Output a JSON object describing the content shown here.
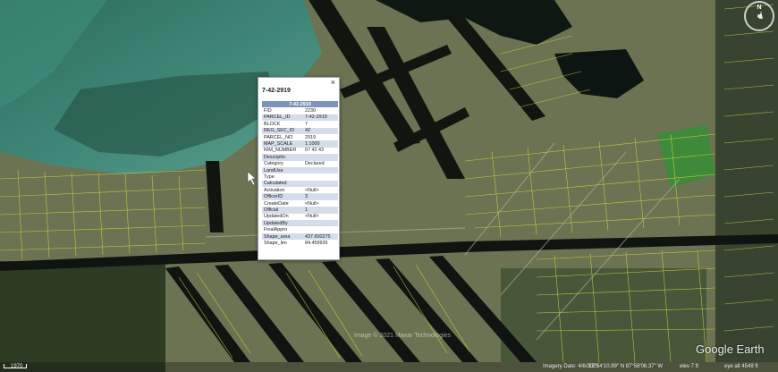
{
  "app": {
    "brand": "Google Earth",
    "watermark": "Image © 2021 Maxar Technologies"
  },
  "compass": {
    "north_label": "N"
  },
  "map": {
    "colors": {
      "sea_deep": "#1f4a3c",
      "sea_shallow": "#3f8576",
      "land": "#6b7352",
      "vegetation": "#2d3b22",
      "canal": "#0f1410",
      "parcel_line": "#d8dc3a"
    }
  },
  "popup": {
    "title": "7-42-2919",
    "table_header": "7-42-2919",
    "close_icon": "close-icon",
    "rows": [
      {
        "field": "FID",
        "value": "2230"
      },
      {
        "field": "PARCEL_ID",
        "value": "7-42-2919"
      },
      {
        "field": "BLOCK",
        "value": "7"
      },
      {
        "field": "REG_SEC_ID",
        "value": "42"
      },
      {
        "field": "PARCEL_NO",
        "value": "2919"
      },
      {
        "field": "MAP_SCALE",
        "value": "1:1000"
      },
      {
        "field": "RIM_NUMBER",
        "value": "07 42 43"
      },
      {
        "field": "Descriptio",
        "value": ""
      },
      {
        "field": "Category",
        "value": "Declared"
      },
      {
        "field": "LandUse",
        "value": ""
      },
      {
        "field": "Type",
        "value": ""
      },
      {
        "field": "Calculated",
        "value": ""
      },
      {
        "field": "Activation",
        "value": "<Null>"
      },
      {
        "field": "OfficerID",
        "value": "3"
      },
      {
        "field": "CreateDate",
        "value": "<Null>"
      },
      {
        "field": "Official",
        "value": "1"
      },
      {
        "field": "UpdatedOn",
        "value": "<Null>"
      },
      {
        "field": "UpdatedBy",
        "value": ""
      },
      {
        "field": "FinalAppro",
        "value": ""
      },
      {
        "field": "Shape_area",
        "value": "437.600275"
      },
      {
        "field": "Shape_len",
        "value": "84.459926"
      }
    ]
  },
  "status_bar": {
    "scale_label": "1970",
    "imagery_date": "Imagery Date: 4/6/2021",
    "coordinates": "17°54'10.99\" N   87°58'06.37\" W",
    "elevation": "elev 7 ft",
    "eye_alt": "eye alt 4549 ft"
  }
}
